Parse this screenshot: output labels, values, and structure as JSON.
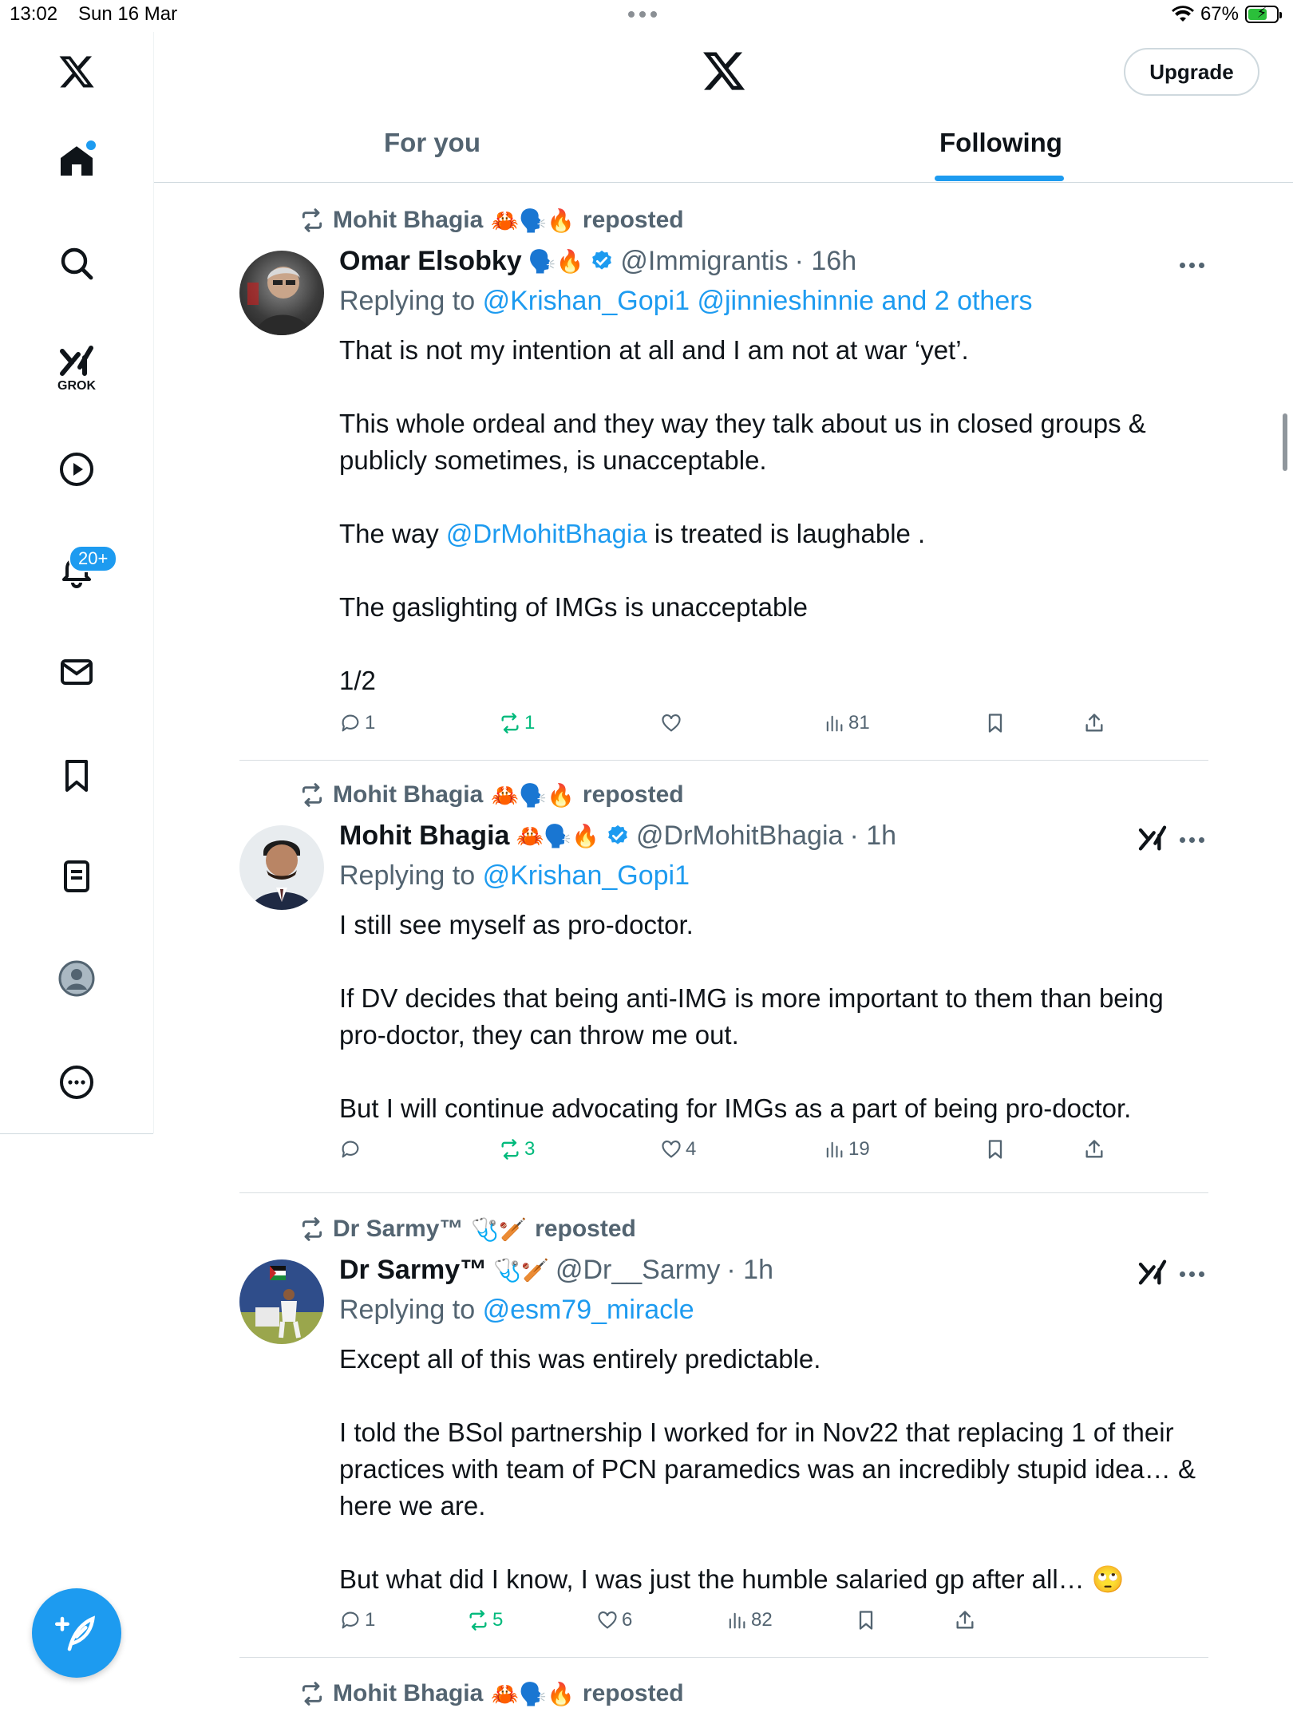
{
  "status_bar": {
    "time": "13:02",
    "date": "Sun 16 Mar",
    "battery": "67%",
    "battery_level": 0.67
  },
  "sidebar": {
    "items": [
      {
        "name": "home"
      },
      {
        "name": "explore"
      },
      {
        "name": "grok",
        "label": "GROK"
      },
      {
        "name": "video"
      },
      {
        "name": "notifications",
        "badge": "20+"
      },
      {
        "name": "messages"
      },
      {
        "name": "bookmarks"
      },
      {
        "name": "lists"
      },
      {
        "name": "profile"
      },
      {
        "name": "more"
      }
    ]
  },
  "header": {
    "upgrade_label": "Upgrade"
  },
  "tabs": [
    {
      "label": "For you",
      "active": false
    },
    {
      "label": "Following",
      "active": true
    }
  ],
  "tweets": [
    {
      "reposted_by": "Mohit Bhagia",
      "reposted_by_emoji": "🦀🗣️🔥",
      "reposted_label": "reposted",
      "name": "Omar Elsobky",
      "name_emoji": "🗣️🔥",
      "handle": "@Immigrantis",
      "time": "· 16h",
      "replying_label": "Replying to",
      "replying_to": "@Krishan_Gopi1 @jinnieshinnie and 2 others",
      "body": [
        "That is not my intention at all and I am not at war ‘yet’.",
        "This whole ordeal and they way they talk about us in closed groups & publicly sometimes, is unacceptable.",
        "The way ",
        "The gaslighting of IMGs is unacceptable",
        "1/2"
      ],
      "body_mention": "@DrMohitBhagia",
      "body_mention_after": " is treated is laughable .",
      "replies": "1",
      "reposts": "1",
      "likes": "",
      "views": "81"
    },
    {
      "reposted_by": "Mohit Bhagia",
      "reposted_by_emoji": "🦀🗣️🔥",
      "reposted_label": "reposted",
      "name": "Mohit Bhagia",
      "name_emoji": "🦀🗣️🔥",
      "handle": "@DrMohitBhagia",
      "time": "· 1h",
      "replying_label": "Replying to",
      "replying_to": "@Krishan_Gopi1",
      "body": [
        "I still see myself as pro-doctor.",
        "If DV decides that being anti-IMG is more important to them than being pro-doctor, they can throw me out.",
        "But I will continue advocating for IMGs as a part of being pro-doctor."
      ],
      "replies": "",
      "reposts": "3",
      "likes": "4",
      "views": "19"
    },
    {
      "reposted_by": "Dr Sarmy™",
      "reposted_by_emoji": "🩺🏏",
      "reposted_label": "reposted",
      "name": "Dr Sarmy™",
      "name_emoji": "🩺🏏",
      "handle": "@Dr__Sarmy",
      "time": "· 1h",
      "replying_label": "Replying to",
      "replying_to": "@esm79_miracle",
      "body": [
        "Except all of this was entirely predictable.",
        "I told the BSol partnership I worked for in Nov22 that replacing 1 of their practices with team of PCN paramedics was an incredibly stupid idea… & here we are.",
        "But what did I know, I was just the humble salaried gp after all… 🙄"
      ],
      "replies": "1",
      "reposts": "5",
      "likes": "6",
      "views": "82"
    },
    {
      "reposted_by": "Mohit Bhagia",
      "reposted_by_emoji": "🦀🗣️🔥",
      "reposted_label": "reposted"
    }
  ],
  "colors": {
    "accent": "#1d9bf0",
    "repost_green": "#00ba7c",
    "secondary_text": "#536471"
  }
}
